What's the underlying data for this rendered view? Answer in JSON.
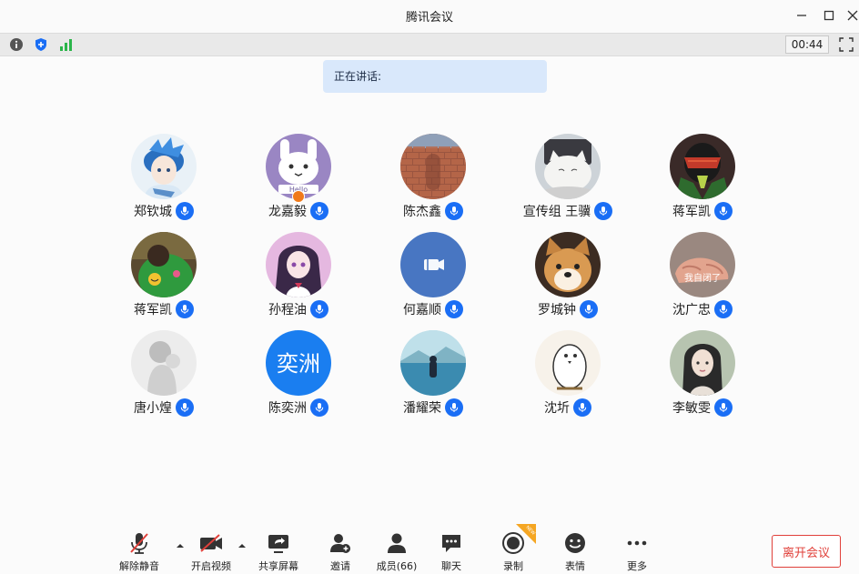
{
  "window": {
    "title": "腾讯会议"
  },
  "infobar": {
    "timer": "00:44"
  },
  "speaking": {
    "label": "正在讲话:"
  },
  "participants": [
    {
      "name": "郑钦城",
      "avatar_theme": "anime-boy-blue"
    },
    {
      "name": "龙嘉毅",
      "avatar_theme": "purple-bunny",
      "host": true
    },
    {
      "name": "陈杰鑫",
      "avatar_theme": "brick-wall"
    },
    {
      "name": "宣传组  王骥",
      "avatar_theme": "white-cat"
    },
    {
      "name": "蒋军凯",
      "avatar_theme": "dark-racer"
    },
    {
      "name": "蒋军凯",
      "avatar_theme": "green-hoodie"
    },
    {
      "name": "孙程油",
      "avatar_theme": "anime-girl-pink"
    },
    {
      "name": "何嘉顺",
      "avatar_theme": "camera-off-blue"
    },
    {
      "name": "罗城钟",
      "avatar_theme": "shiba-dog"
    },
    {
      "name": "沈广忠",
      "avatar_theme": "fingers",
      "overlay": "我自闭了"
    },
    {
      "name": "唐小煌",
      "avatar_theme": "grey-sketch"
    },
    {
      "name": "陈奕洲",
      "avatar_theme": "text-avatar",
      "avatar_text": "奕洲"
    },
    {
      "name": "潘耀荣",
      "avatar_theme": "lake-scene"
    },
    {
      "name": "沈圻",
      "avatar_theme": "white-bird"
    },
    {
      "name": "李敏雯",
      "avatar_theme": "girl-portrait"
    }
  ],
  "toolbar": {
    "unmute": "解除静音",
    "start_video": "开启视频",
    "share_screen": "共享屏幕",
    "invite": "邀请",
    "members": "成员(66)",
    "chat": "聊天",
    "record": "录制",
    "record_badge": "NEW",
    "reactions": "表情",
    "more": "更多",
    "leave": "离开会议"
  },
  "colors": {
    "accent": "#1a6ef5",
    "leave": "#e0403a",
    "banner": "#d9e8fb"
  }
}
